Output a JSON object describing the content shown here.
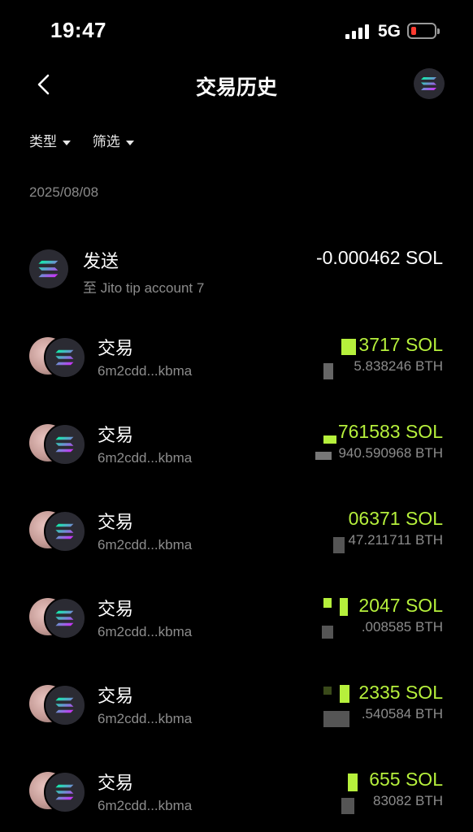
{
  "status": {
    "time": "19:47",
    "network": "5G"
  },
  "nav": {
    "title": "交易历史"
  },
  "filters": [
    {
      "label": "类型"
    },
    {
      "label": "筛选"
    }
  ],
  "date": "2025/08/08",
  "transactions": [
    {
      "title": "发送",
      "subtitle": "至 Jito tip account 7",
      "amount": "-0.000462 SOL",
      "secondary": ""
    },
    {
      "title": "交易",
      "subtitle": "6m2cdd...kbma",
      "amount": "3717 SOL",
      "secondary": "5.838246 BTH"
    },
    {
      "title": "交易",
      "subtitle": "6m2cdd...kbma",
      "amount": "761583 SOL",
      "secondary": "940.590968 BTH"
    },
    {
      "title": "交易",
      "subtitle": "6m2cdd...kbma",
      "amount": "06371 SOL",
      "secondary": "47.211711 BTH"
    },
    {
      "title": "交易",
      "subtitle": "6m2cdd...kbma",
      "amount": "2047 SOL",
      "secondary": ".008585 BTH"
    },
    {
      "title": "交易",
      "subtitle": "6m2cdd...kbma",
      "amount": "2335 SOL",
      "secondary": ".540584 BTH"
    },
    {
      "title": "交易",
      "subtitle": "6m2cdd...kbma",
      "amount": "655 SOL",
      "secondary": "83082 BTH"
    }
  ],
  "colors": {
    "positive": "#b6f03c",
    "muted": "#8c8c8c",
    "background": "#000000"
  },
  "icons": {
    "back": "chevron-left-icon",
    "token": "solana-icon",
    "filter": "caret-down-icon"
  }
}
